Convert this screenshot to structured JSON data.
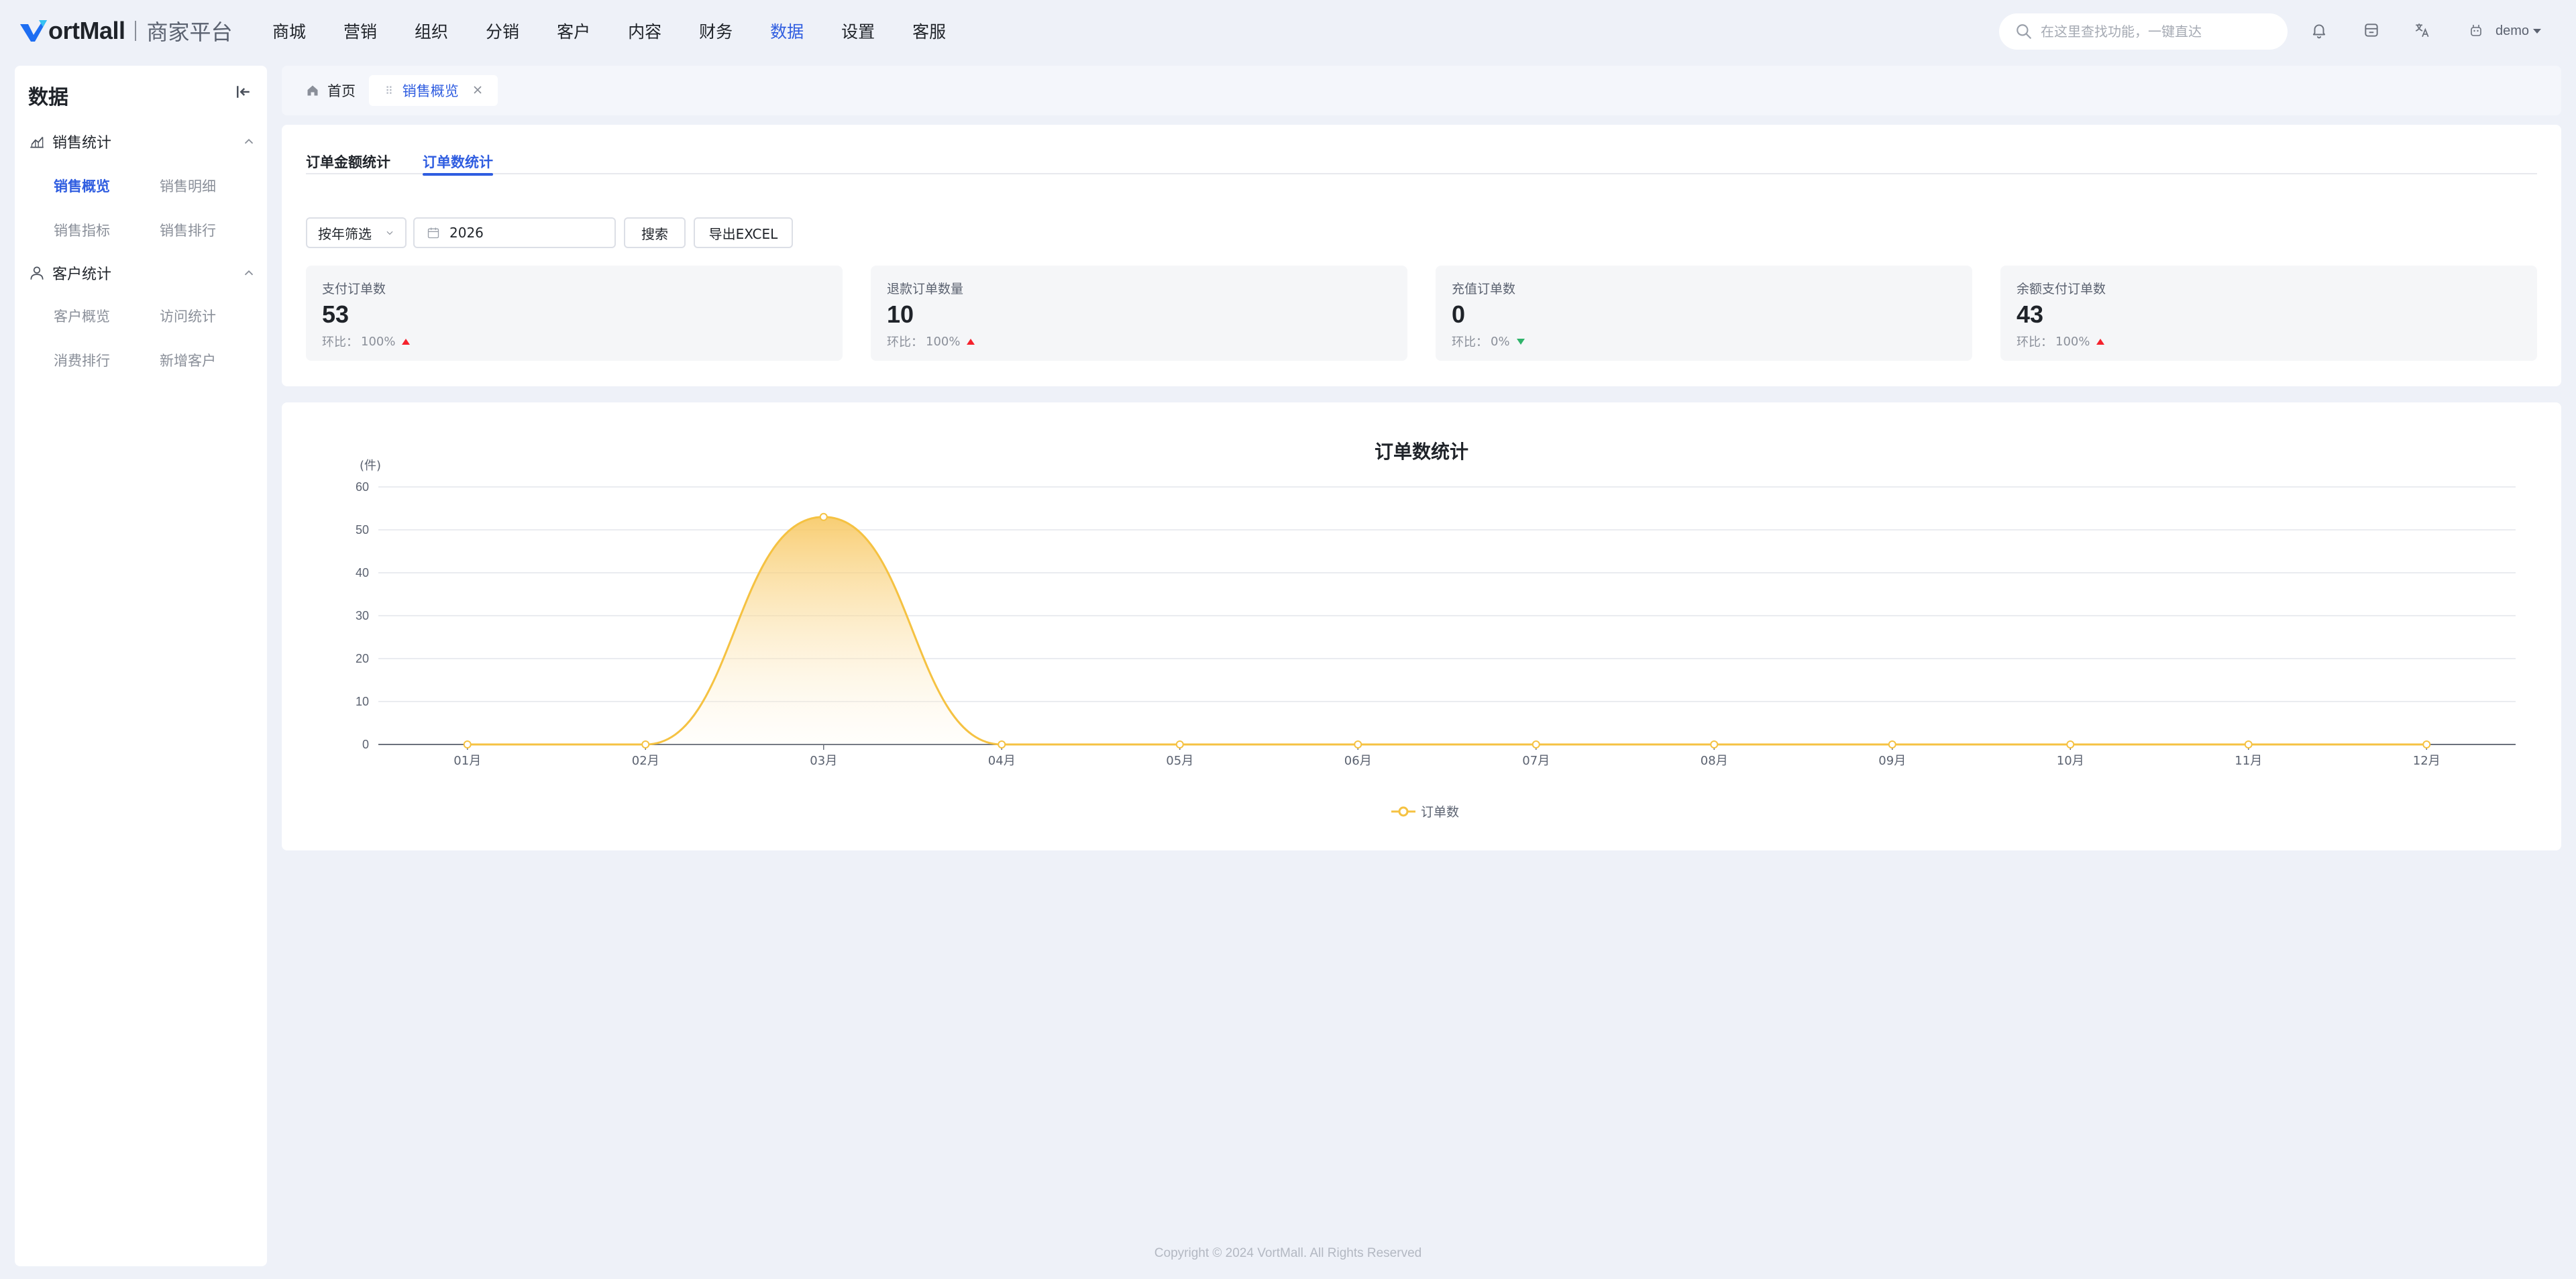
{
  "app": {
    "brand": "VortMall",
    "brand_rest": "ortMall",
    "subtitle": "商家平台"
  },
  "nav": [
    "商城",
    "营销",
    "组织",
    "分销",
    "客户",
    "内容",
    "财务",
    "数据",
    "设置",
    "客服"
  ],
  "nav_active": "数据",
  "search": {
    "placeholder": "在这里查找功能，一键直达"
  },
  "user": {
    "name": "demo"
  },
  "sidebar": {
    "title": "数据",
    "groups": [
      {
        "label": "销售统计",
        "items": [
          "销售概览",
          "销售明细",
          "销售指标",
          "销售排行"
        ]
      },
      {
        "label": "客户统计",
        "items": [
          "客户概览",
          "访问统计",
          "消费排行",
          "新增客户"
        ]
      }
    ],
    "active": "销售概览"
  },
  "page_tabs": {
    "home": "首页",
    "current": "销售概览"
  },
  "subtabs": [
    "订单金额统计",
    "订单数统计"
  ],
  "subtab_active": "订单数统计",
  "filters": {
    "mode": "按年筛选",
    "year": "2026",
    "search_btn": "搜索",
    "export_btn": "导出EXCEL"
  },
  "stats": [
    {
      "label": "支付订单数",
      "value": "53",
      "cmp_label": "环比：",
      "cmp": "100%",
      "trend": "up"
    },
    {
      "label": "退款订单数量",
      "value": "10",
      "cmp_label": "环比：",
      "cmp": "100%",
      "trend": "up"
    },
    {
      "label": "充值订单数",
      "value": "0",
      "cmp_label": "环比：",
      "cmp": "0%",
      "trend": "down"
    },
    {
      "label": "余额支付订单数",
      "value": "43",
      "cmp_label": "环比：",
      "cmp": "100%",
      "trend": "up"
    }
  ],
  "colors": {
    "accent": "#2f5de0",
    "series": "#f5c242",
    "up": "#f5222d",
    "down": "#2fb36a"
  },
  "chart_data": {
    "type": "area",
    "title": "订单数统计",
    "yunit": "(件)",
    "categories": [
      "01月",
      "02月",
      "03月",
      "04月",
      "05月",
      "06月",
      "07月",
      "08月",
      "09月",
      "10月",
      "11月",
      "12月"
    ],
    "series": [
      {
        "name": "订单数",
        "values": [
          0,
          0,
          53,
          0,
          0,
          0,
          0,
          0,
          0,
          0,
          0,
          0
        ]
      }
    ],
    "ylim": [
      0,
      60
    ],
    "yticks": [
      0,
      10,
      20,
      30,
      40,
      50,
      60
    ],
    "grid": true,
    "legend": "bottom-center"
  },
  "footer": "Copyright © 2024 VortMall. All Rights Reserved"
}
